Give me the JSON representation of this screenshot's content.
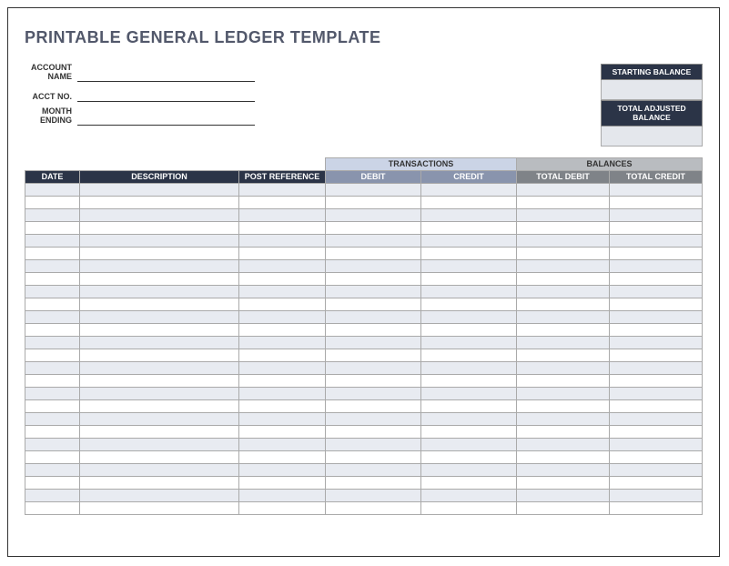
{
  "title": "PRINTABLE GENERAL LEDGER TEMPLATE",
  "fields": {
    "account_name": {
      "label": "ACCOUNT NAME",
      "value": ""
    },
    "acct_no": {
      "label": "ACCT NO.",
      "value": ""
    },
    "month_ending": {
      "label": "MONTH ENDING",
      "value": ""
    }
  },
  "balance_boxes": {
    "starting": {
      "label": "STARTING BALANCE",
      "value": ""
    },
    "total_adjusted": {
      "label": "TOTAL ADJUSTED BALANCE",
      "value": ""
    }
  },
  "group_headers": {
    "transactions": "TRANSACTIONS",
    "balances": "BALANCES"
  },
  "columns": {
    "date": "DATE",
    "description": "DESCRIPTION",
    "post_reference": "POST REFERENCE",
    "debit": "DEBIT",
    "credit": "CREDIT",
    "total_debit": "TOTAL DEBIT",
    "total_credit": "TOTAL CREDIT"
  },
  "row_count": 26
}
